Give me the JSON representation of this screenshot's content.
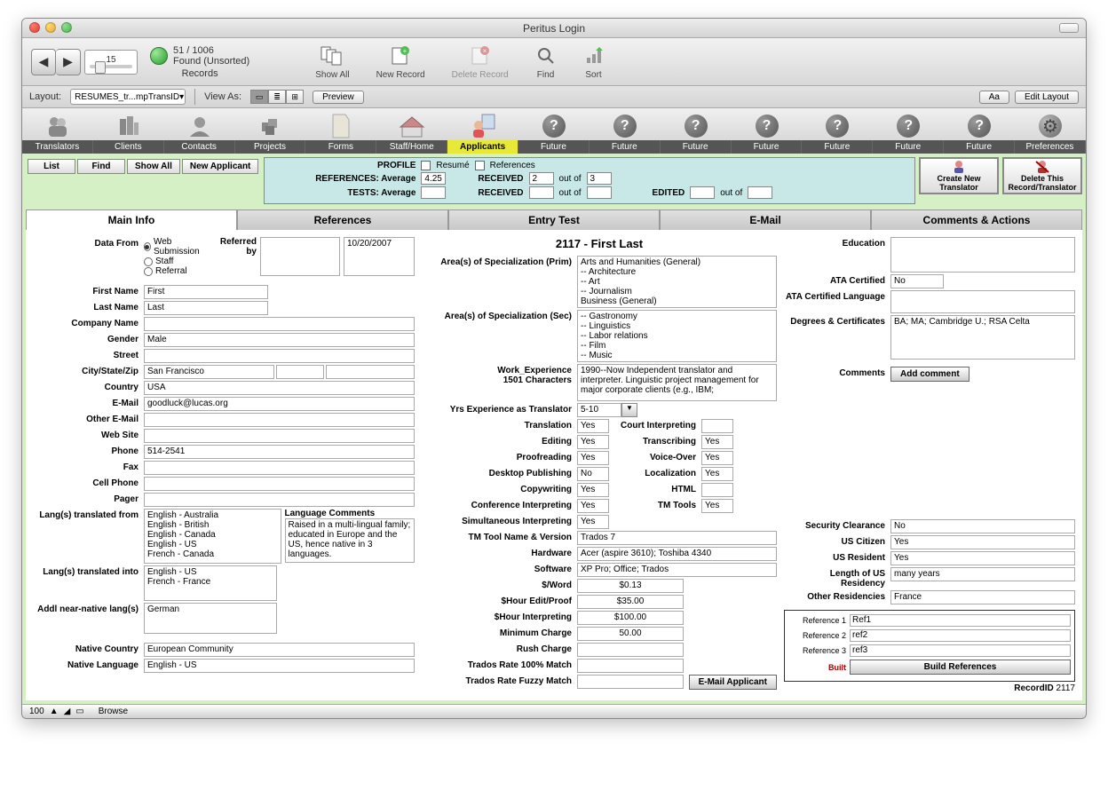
{
  "window": {
    "title": "Peritus Login"
  },
  "toolbar1": {
    "slider_value": "15",
    "found_count": "51 / 1006",
    "found_status": "Found (Unsorted)",
    "records_label": "Records",
    "items": {
      "show_all": "Show All",
      "new_record": "New Record",
      "delete_record": "Delete Record",
      "find": "Find",
      "sort": "Sort"
    }
  },
  "toolbar2": {
    "layout_label": "Layout:",
    "layout_value": "RESUMES_tr...mpTransID",
    "viewas_label": "View As:",
    "preview": "Preview",
    "aa": "Aa",
    "edit_layout": "Edit Layout"
  },
  "mainnav": [
    "Translators",
    "Clients",
    "Contacts",
    "Projects",
    "Forms",
    "Staff/Home",
    "Applicants",
    "Future",
    "Future",
    "Future",
    "Future",
    "Future",
    "Future",
    "Future",
    "Preferences"
  ],
  "mainnav_active_index": 6,
  "subbuttons": {
    "list": "List",
    "find": "Find",
    "show_all": "Show All",
    "new_applicant": "New Applicant"
  },
  "profile": {
    "profile_label": "PROFILE",
    "resume": "Resumé",
    "references": "References",
    "refs_avg_label": "REFERENCES: Average",
    "refs_avg": "4.25",
    "received1_label": "RECEIVED",
    "received1_a": "2",
    "received1_out": "out of",
    "received1_b": "3",
    "tests_avg_label": "TESTS: Average",
    "tests_avg": "",
    "received2_label": "RECEIVED",
    "received2_a": "",
    "received2_out": "out of",
    "received2_b": "",
    "edited_label": "EDITED",
    "edited_a": "",
    "edited_out": "out of",
    "edited_b": ""
  },
  "actions": {
    "create": "Create New Translator",
    "delete": "Delete This Record/Translator"
  },
  "tabs": [
    "Main Info",
    "References",
    "Entry Test",
    "E-Mail",
    "Comments & Actions"
  ],
  "active_tab": 0,
  "record_title": "2117 - First Last",
  "form": {
    "data_from_label": "Data From",
    "data_from_options": [
      "Web Submission",
      "Staff",
      "Referral"
    ],
    "data_from_selected": 0,
    "referred_by_label": "Referred by",
    "referred_by": "",
    "referred_date": "10/20/2007",
    "first_name_label": "First Name",
    "first_name": "First",
    "last_name_label": "Last Name",
    "last_name": "Last",
    "company_label": "Company Name",
    "company": "",
    "gender_label": "Gender",
    "gender": "Male",
    "street_label": "Street",
    "street": "",
    "csz_label": "City/State/Zip",
    "city": "San Francisco",
    "state": "",
    "zip": "",
    "country_label": "Country",
    "country": "USA",
    "email_label": "E-Mail",
    "email": "goodluck@lucas.org",
    "other_email_label": "Other E-Mail",
    "other_email": "",
    "website_label": "Web Site",
    "website": "",
    "phone_label": "Phone",
    "phone": "514-2541",
    "fax_label": "Fax",
    "fax": "",
    "cell_label": "Cell Phone",
    "cell": "",
    "pager_label": "Pager",
    "pager": "",
    "lang_from_label": "Lang(s) translated from",
    "lang_from": "English - Australia\nEnglish - British\nEnglish - Canada\nEnglish - US\nFrench - Canada",
    "lang_comments_label": "Language Comments",
    "lang_comments": "Raised in a multi-lingual family; educated in Europe and the US, hence native in 3 languages.",
    "lang_into_label": "Lang(s) translated into",
    "lang_into": "English - US\nFrench - France",
    "addl_near_label": "Addl near-native lang(s)",
    "addl_near": "German",
    "native_country_label": "Native Country",
    "native_country": "European Community",
    "native_language_label": "Native Language",
    "native_language": "English - US"
  },
  "form2": {
    "spec_prim_label": "Area(s) of Specialization (Prim)",
    "spec_prim": "Arts and Humanities (General)\n-- Architecture\n-- Art\n-- Journalism\nBusiness (General)",
    "spec_sec_label": "Area(s) of Specialization (Sec)",
    "spec_sec": "-- Gastronomy\n-- Linguistics\n-- Labor relations\n-- Film\n-- Music",
    "work_exp_label": "Work_Experience\n1501 Characters",
    "work_exp": "1990--Now   Independent translator and interpreter. Linguistic project management for major corporate clients (e.g., IBM;",
    "yrs_exp_label": "Yrs Experience as Translator",
    "yrs_exp": "5-10",
    "translation_label": "Translation",
    "translation": "Yes",
    "editing_label": "Editing",
    "editing": "Yes",
    "proof_label": "Proofreading",
    "proof": "Yes",
    "dtp_label": "Desktop Publishing",
    "dtp": "No",
    "copy_label": "Copywriting",
    "copy": "Yes",
    "conf_label": "Conference Interpreting",
    "conf": "Yes",
    "sim_label": "Simultaneous Interpreting",
    "sim": "Yes",
    "court_label": "Court Interpreting",
    "court": "",
    "transcr_label": "Transcribing",
    "transcr": "Yes",
    "voice_label": "Voice-Over",
    "voice": "Yes",
    "local_label": "Localization",
    "local": "Yes",
    "html_label": "HTML",
    "html": "",
    "tmtools_label": "TM Tools",
    "tmtools": "Yes",
    "tmtool_name_label": "TM Tool Name & Version",
    "tmtool_name": "Trados 7",
    "hardware_label": "Hardware",
    "hardware": "Acer (aspire 3610); Toshiba 4340",
    "software_label": "Software",
    "software": "XP Pro; Office; Trados",
    "word_label": "$/Word",
    "word": "$0.13",
    "edit_rate_label": "$Hour Edit/Proof",
    "edit_rate": "$35.00",
    "interp_rate_label": "$Hour Interpreting",
    "interp_rate": "$100.00",
    "min_charge_label": "Minimum Charge",
    "min_charge": "50.00",
    "rush_label": "Rush Charge",
    "rush": "",
    "trados100_label": "Trados Rate 100% Match",
    "trados100": "",
    "tradosfuzzy_label": "Trados Rate Fuzzy Match",
    "tradosfuzzy": "",
    "email_applicant": "E-Mail Applicant"
  },
  "form3": {
    "education_label": "Education",
    "education": "",
    "ata_cert_label": "ATA Certified",
    "ata_cert": "No",
    "ata_lang_label": "ATA Certified Language",
    "ata_lang": "",
    "degrees_label": "Degrees & Certificates",
    "degrees": "BA; MA; Cambridge U.; RSA Celta",
    "comments_label": "Comments",
    "add_comment": "Add comment",
    "sec_clear_label": "Security Clearance",
    "sec_clear": "No",
    "us_cit_label": "US Citizen",
    "us_cit": "Yes",
    "us_res_label": "US Resident",
    "us_res": "Yes",
    "len_us_label": "Length of US Residency",
    "len_us": "many years",
    "other_res_label": "Other Residencies",
    "other_res": "France",
    "ref1_label": "Reference 1",
    "ref1": "Ref1",
    "ref2_label": "Reference 2",
    "ref2": "ref2",
    "ref3_label": "Reference 3",
    "ref3": "ref3",
    "built": "Built",
    "build_refs": "Build References",
    "recordid_label": "RecordID",
    "recordid": "2117"
  },
  "statusbar": {
    "zoom": "100",
    "mode": "Browse"
  }
}
